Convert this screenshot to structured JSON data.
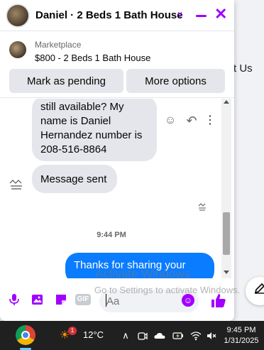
{
  "background": {
    "right_text": "t Us"
  },
  "chat": {
    "title": "Daniel · 2 Beds 1 Bath House",
    "accent_color": "#a100ff",
    "listing": {
      "label": "Marketplace",
      "title": "$800 - 2 Beds 1 Bath House"
    },
    "buttons": {
      "pending": "Mark as pending",
      "more": "More options"
    },
    "messages": {
      "incoming_1_lines": [
        "still available? My",
        "name is Daniel",
        "Hernandez number is",
        "208-516-8864"
      ],
      "incoming_2": "Message sent",
      "timestamp": "9:44 PM",
      "outgoing_1": "Thanks for sharing your"
    },
    "composer": {
      "placeholder": "Aa",
      "gif_label": "GIF",
      "icons": [
        "microphone-icon",
        "photo-icon",
        "sticker-icon",
        "gif-icon",
        "emoji-icon",
        "like-icon"
      ]
    }
  },
  "watermark": {
    "line1": "Activate Windows",
    "line2": "Go to Settings to activate Windows."
  },
  "taskbar": {
    "weather_temp": "12°C",
    "weather_badge": "1",
    "time": "9:45 PM",
    "date": "1/31/2025"
  }
}
